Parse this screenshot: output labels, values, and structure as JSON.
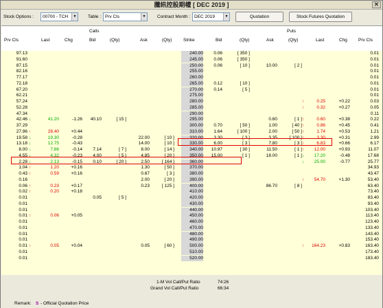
{
  "title": "騰訊控股期權 [ DEC 2019 ]",
  "toolbar": {
    "stock_label": "Stock Options :",
    "stock_value": "00700 - TCH",
    "table_label": "Table :",
    "table_value": "Prv Cls",
    "contract_label": "Contract Month :",
    "contract_value": "DEC  2019",
    "quotation_btn": "Quotation",
    "sf_btn": "Stock Futures Quotation"
  },
  "sections": {
    "calls": "Calls",
    "puts": "Puts"
  },
  "headers": [
    "Prv Cls",
    "Last",
    "Chg",
    "Bid",
    "(Qty)",
    "Ask",
    "(Qty)",
    "Strike",
    "Bid",
    "(Qty)",
    "Ask",
    "(Qty)",
    "Last",
    "Chg",
    "Prv Cls"
  ],
  "rows": [
    {
      "cp": "97.13",
      "strike": "240.00",
      "pbid": "0.06",
      "pbq": "350",
      "pp": "0.01"
    },
    {
      "cp": "91.60",
      "strike": "245.00",
      "pbid": "0.06",
      "pbq": "350",
      "pp": "0.01"
    },
    {
      "cp": "87.15",
      "strike": "250.00",
      "pbid": "0.06",
      "pbq": "10",
      "pask": "10.00",
      "paq": "2",
      "pp": "0.01"
    },
    {
      "cp": "82.16",
      "strike": "255.00",
      "pp": "0.01"
    },
    {
      "cp": "77.17",
      "strike": "260.00",
      "pp": "0.01"
    },
    {
      "cp": "72.18",
      "strike": "265.00",
      "pbid": "0.12",
      "pbq": "10",
      "pp": "0.01"
    },
    {
      "cp": "67.20",
      "strike": "270.00",
      "pbid": "0.14",
      "pbq": "5",
      "pp": "0.01"
    },
    {
      "cp": "62.21",
      "strike": "275.00",
      "pp": "0.01"
    },
    {
      "cp": "57.24",
      "strike": "280.00",
      "plast": "0.25",
      "plast_dir": "up",
      "pchg": "+0.22",
      "pp": "0.03"
    },
    {
      "cp": "52.28",
      "strike": "285.00",
      "plast": "0.32",
      "plast_dir": "up",
      "pchg": "+0.27",
      "pp": "0.05"
    },
    {
      "cp": "47.34",
      "strike": "290.00",
      "pp": "0.11"
    },
    {
      "cp": "42.46",
      "cp_dir": "dn",
      "clast": "41.20",
      "clast_c": "grn",
      "cchg": "-1.26",
      "cbid": "40.10",
      "cbq": "15",
      "strike": "295.00",
      "pask": "0.60",
      "paq": "1",
      "plast": "0.60",
      "plast_dir": "up",
      "pchg": "+0.38",
      "pp": "0.22"
    },
    {
      "cp": "37.29",
      "strike": "300.00",
      "pbid": "0.70",
      "pbq": "50",
      "pask": "1.00",
      "paq": "40",
      "plast": "0.86",
      "plast_dir": "up",
      "pchg": "+0.45",
      "pp": "0.41"
    },
    {
      "cp": "27.96",
      "cp_dir": "up",
      "clast": "28.40",
      "clast_c": "red",
      "cchg": "+0.44",
      "strike": "310.00",
      "pbid": "1.64",
      "pbq": "100",
      "pask": "2.00",
      "paq": "50",
      "plast": "1.74",
      "plast_dir": "up",
      "pchg": "+0.53",
      "pp": "1.21"
    },
    {
      "cp": "19.58",
      "cp_dir": "dn",
      "clast": "19.30",
      "clast_c": "grn",
      "cchg": "-0.28",
      "cask": "22.00",
      "caq": "10",
      "strike": "320.00",
      "pbid": "3.30",
      "pbq": "3",
      "pask": "3.35",
      "paq": "100",
      "plast": "3.30",
      "plast_dir": "up",
      "pchg": "+0.31",
      "pp": "2.99"
    },
    {
      "cp": "13.18",
      "cp_dir": "dn",
      "clast": "12.75",
      "clast_c": "grn",
      "cchg": "-0.43",
      "cask": "14.00",
      "caq": "10",
      "strike": "330.00",
      "pbid": "6.00",
      "pbq": "3",
      "pask": "7.80",
      "paq": "3",
      "plast": "6.83",
      "plast_dir": "up",
      "pchg": "+0.66",
      "pp": "6.17"
    },
    {
      "cp": "8.00",
      "cp_dir": "dn",
      "clast": "7.86",
      "clast_c": "grn",
      "cchg": "-0.14",
      "cbid": "7.14",
      "cbq": "7",
      "cask": "8.00",
      "caq": "14",
      "strike": "340.00",
      "pbid": "10.97",
      "pbq": "30",
      "pask": "11.50",
      "paq": "1",
      "plast": "12.00",
      "plast_dir": "up",
      "pchg": "+0.93",
      "pp": "11.07"
    },
    {
      "cp": "4.55",
      "cp_dir": "dn",
      "clast": "4.32",
      "clast_c": "grn",
      "cchg": "-0.23",
      "cbid": "4.00",
      "cbq": "5",
      "cask": "4.85",
      "caq": "20",
      "strike": "350.00",
      "pbid": "15.00",
      "pbq": "1",
      "pask": "18.00",
      "paq": "1",
      "plast": "17.20",
      "plast_dir": "dn",
      "pchg": "-0.48",
      "pp": "17.68"
    },
    {
      "cp": "2.28",
      "cp_dir": "dn",
      "clast": "2.13",
      "clast_c": "grn",
      "cchg": "-0.15",
      "cbid": "0.10",
      "cbq": "20",
      "cask": "2.50",
      "caq": "164",
      "strike": "360.00",
      "plast": "25.00",
      "plast_dir": "dn",
      "pchg": "-0.77",
      "pp": "25.77"
    },
    {
      "cp": "1.04",
      "cp_dir": "up",
      "clast": "1.20",
      "clast_c": "red",
      "cchg": "+0.16",
      "cask": "1.30",
      "caq": "50",
      "strike": "370.00",
      "pp": "34.93"
    },
    {
      "cp": "0.43",
      "cp_dir": "up",
      "clast": "0.59",
      "clast_c": "red",
      "cchg": "+0.16",
      "cask": "0.67",
      "caq": "3",
      "strike": "380.00",
      "pp": "43.47"
    },
    {
      "cp": "0.16",
      "cask": "2.00",
      "caq": "20",
      "strike": "390.00",
      "plast": "54.70",
      "plast_dir": "up",
      "pchg": "+1.30",
      "pp": "53.40"
    },
    {
      "cp": "0.06",
      "cp_dir": "up",
      "clast": "0.23",
      "clast_c": "red",
      "cchg": "+0.17",
      "cask": "0.23",
      "caq": "125",
      "strike": "400.00",
      "pask": "86.70",
      "paq": "8",
      "pp": "63.40"
    },
    {
      "cp": "0.02",
      "cp_dir": "up",
      "clast": "0.20",
      "clast_c": "red",
      "cchg": "+0.18",
      "strike": "410.00",
      "pp": "73.40"
    },
    {
      "cp": "0.01",
      "cbid": "0.05",
      "cbq": "5",
      "strike": "420.00",
      "pp": "83.40"
    },
    {
      "cp": "0.01",
      "strike": "430.00",
      "pp": "93.40"
    },
    {
      "cp": "0.01",
      "strike": "440.00",
      "pp": "103.40"
    },
    {
      "cp": "0.01",
      "cp_dir": "up",
      "clast": "0.06",
      "clast_c": "red",
      "cchg": "+0.05",
      "strike": "450.00",
      "pp": "113.40"
    },
    {
      "cp": "0.01",
      "strike": "460.00",
      "pp": "123.40"
    },
    {
      "cp": "0.01",
      "strike": "470.00",
      "pp": "133.40"
    },
    {
      "cp": "0.01",
      "strike": "480.00",
      "pp": "143.40"
    },
    {
      "cp": "0.01",
      "strike": "490.00",
      "pp": "153.40"
    },
    {
      "cp": "0.01",
      "cp_dir": "up",
      "clast": "0.05",
      "clast_c": "red",
      "cchg": "+0.04",
      "cask": "0.05",
      "caq": "60",
      "strike": "500.00",
      "plast": "164.23",
      "plast_dir": "up",
      "pchg": "+0.83",
      "pp": "163.40"
    },
    {
      "cp": "0.01",
      "strike": "510.00",
      "pp": "173.40"
    },
    {
      "cp": "0.01",
      "strike": "520.00",
      "pp": "183.40"
    }
  ],
  "footer": {
    "r1_label": "1-M Vol Call/Put Ratio",
    "r1_value": "74:26",
    "r2_label": "Grand Vol Call/Put Ratio",
    "r2_value": "66:34",
    "remark_label": "Remark:",
    "remark_symbol": "S",
    "remark_text": "- Official Quotation Price"
  },
  "colors": {
    "up": "#dd0000",
    "down": "#00aa00",
    "grid_bg": "#ffffd8",
    "highlight": "#e00000"
  }
}
